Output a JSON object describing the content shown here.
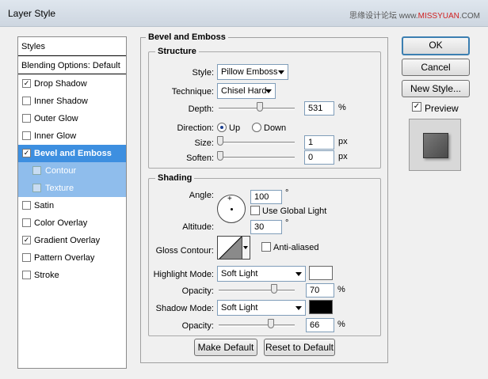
{
  "window": {
    "title": "Layer Style",
    "watermark_prefix": "思缘设计论坛 www.",
    "watermark_accent": "MISSYUAN",
    "watermark_suffix": ".COM"
  },
  "styles_panel": {
    "header": "Styles",
    "blending": "Blending Options: Default",
    "items": [
      {
        "label": "Drop Shadow",
        "checked": true
      },
      {
        "label": "Inner Shadow",
        "checked": false
      },
      {
        "label": "Outer Glow",
        "checked": false
      },
      {
        "label": "Inner Glow",
        "checked": false
      },
      {
        "label": "Bevel and Emboss",
        "checked": true
      },
      {
        "label": "Contour",
        "checked": false
      },
      {
        "label": "Texture",
        "checked": false
      },
      {
        "label": "Satin",
        "checked": false
      },
      {
        "label": "Color Overlay",
        "checked": false
      },
      {
        "label": "Gradient Overlay",
        "checked": true
      },
      {
        "label": "Pattern Overlay",
        "checked": false
      },
      {
        "label": "Stroke",
        "checked": false
      }
    ],
    "check_mark": "✓"
  },
  "bevel": {
    "section_title": "Bevel and Emboss",
    "structure_title": "Structure",
    "style_label": "Style:",
    "style_value": "Pillow Emboss",
    "technique_label": "Technique:",
    "technique_value": "Chisel Hard",
    "depth_label": "Depth:",
    "depth_value": "531",
    "depth_unit": "%",
    "direction_label": "Direction:",
    "direction_up": "Up",
    "direction_down": "Down",
    "size_label": "Size:",
    "size_value": "1",
    "size_unit": "px",
    "soften_label": "Soften:",
    "soften_value": "0",
    "soften_unit": "px"
  },
  "shading": {
    "title": "Shading",
    "angle_label": "Angle:",
    "angle_value": "100",
    "degree": "°",
    "global_light": "Use Global Light",
    "altitude_label": "Altitude:",
    "altitude_value": "30",
    "gloss_label": "Gloss Contour:",
    "anti_aliased": "Anti-aliased",
    "highlight_label": "Highlight Mode:",
    "highlight_value": "Soft Light",
    "highlight_color": "#ffffff",
    "hl_opacity_label": "Opacity:",
    "hl_opacity_value": "70",
    "shadow_label": "Shadow Mode:",
    "shadow_value": "Soft Light",
    "shadow_color": "#000000",
    "sh_opacity_label": "Opacity:",
    "sh_opacity_value": "66",
    "pct": "%"
  },
  "buttons": {
    "make_default": "Make Default",
    "reset_default": "Reset to Default",
    "ok": "OK",
    "cancel": "Cancel",
    "new_style": "New Style...",
    "preview": "Preview"
  },
  "colors": {
    "selection": "#3d8fe0",
    "sub_selection": "#8fbdec"
  }
}
